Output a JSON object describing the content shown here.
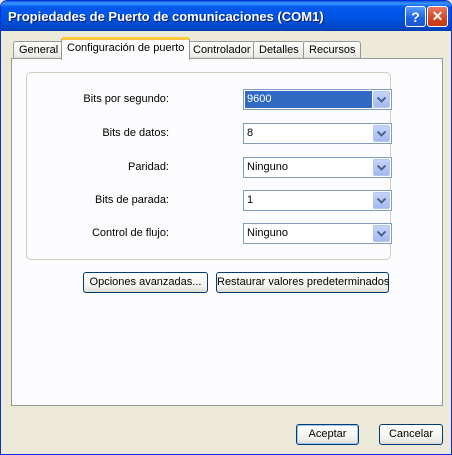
{
  "window": {
    "title": "Propiedades de Puerto de comunicaciones (COM1)",
    "help_glyph": "?",
    "close_glyph": "✕"
  },
  "tabs": [
    {
      "label": "General",
      "active": false
    },
    {
      "label": "Configuración de puerto",
      "active": true
    },
    {
      "label": "Controlador",
      "active": false
    },
    {
      "label": "Detalles",
      "active": false
    },
    {
      "label": "Recursos",
      "active": false
    }
  ],
  "settings": {
    "bits_per_second": {
      "label": "Bits por segundo:",
      "value": "9600"
    },
    "data_bits": {
      "label": "Bits de datos:",
      "value": "8"
    },
    "parity": {
      "label": "Paridad:",
      "value": "Ninguno"
    },
    "stop_bits": {
      "label": "Bits de parada:",
      "value": "1"
    },
    "flow_control": {
      "label": "Control de flujo:",
      "value": "Ninguno"
    }
  },
  "actions": {
    "advanced_label": "Opciones avanzadas...",
    "restore_label": "Restaurar valores predeterminados"
  },
  "footer": {
    "ok_label": "Aceptar",
    "cancel_label": "Cancelar"
  },
  "colors": {
    "titlebar": "#0054e3",
    "selection": "#316ac5",
    "active_tab_accent": "#ffc83c",
    "dialog_bg": "#ece9d8"
  }
}
